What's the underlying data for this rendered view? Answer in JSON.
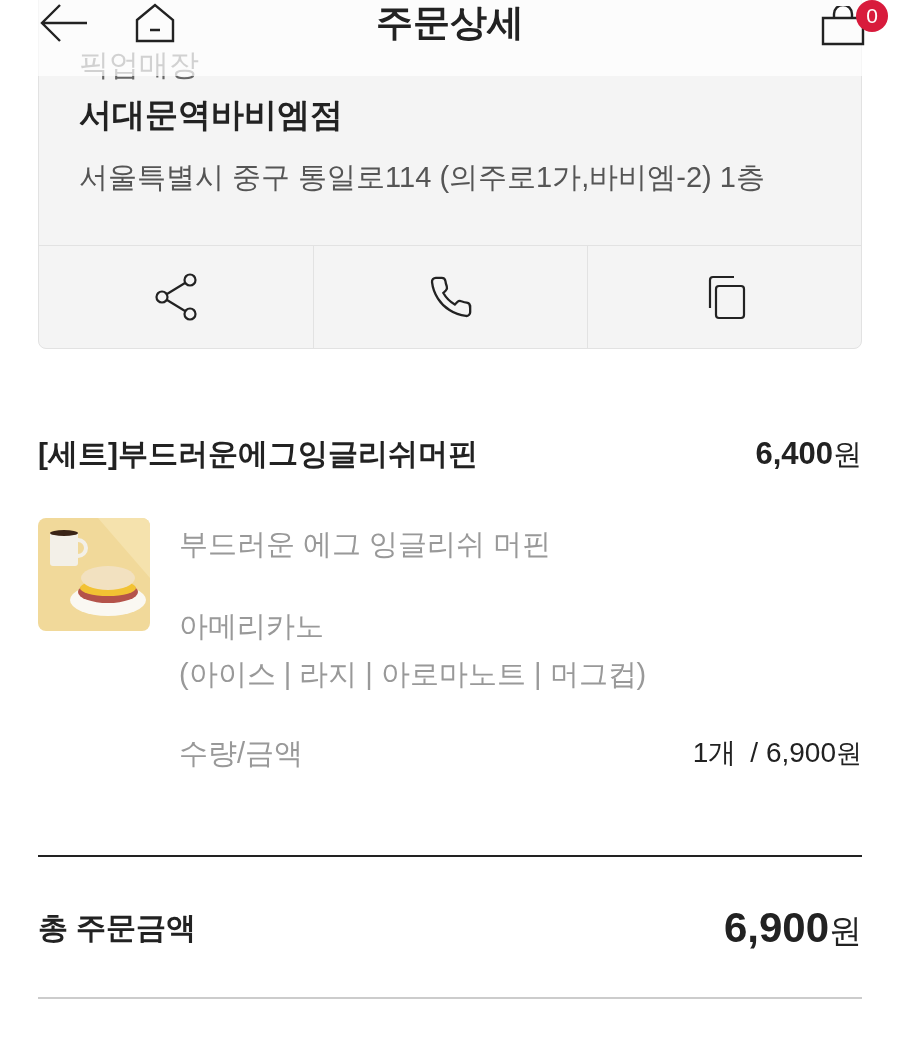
{
  "header": {
    "title": "주문상세",
    "cart_count": "0"
  },
  "store": {
    "label": "픽업매장",
    "name": "서대문역바비엠점",
    "address": "서울특별시 중구 통일로114 (의주로1가,바비엠-2) 1층"
  },
  "store_actions": [
    {
      "kind": "share"
    },
    {
      "kind": "call"
    },
    {
      "kind": "copy"
    }
  ],
  "order_item": {
    "name": "[세트]부드러운에그잉글리쉬머핀",
    "price": "6,400",
    "price_unit": "원",
    "components": [
      {
        "name": "부드러운 에그 잉글리쉬 머핀"
      },
      {
        "name": "아메리카노",
        "detail": "(아이스 | 라지 | 아로마노트 | 머그컵)"
      }
    ],
    "quantity_label": "수량/금액",
    "quantity": "1개",
    "amount": "/ 6,900",
    "amount_unit": "원"
  },
  "total": {
    "label": "총 주문금액",
    "amount": "6,900",
    "unit": "원"
  }
}
